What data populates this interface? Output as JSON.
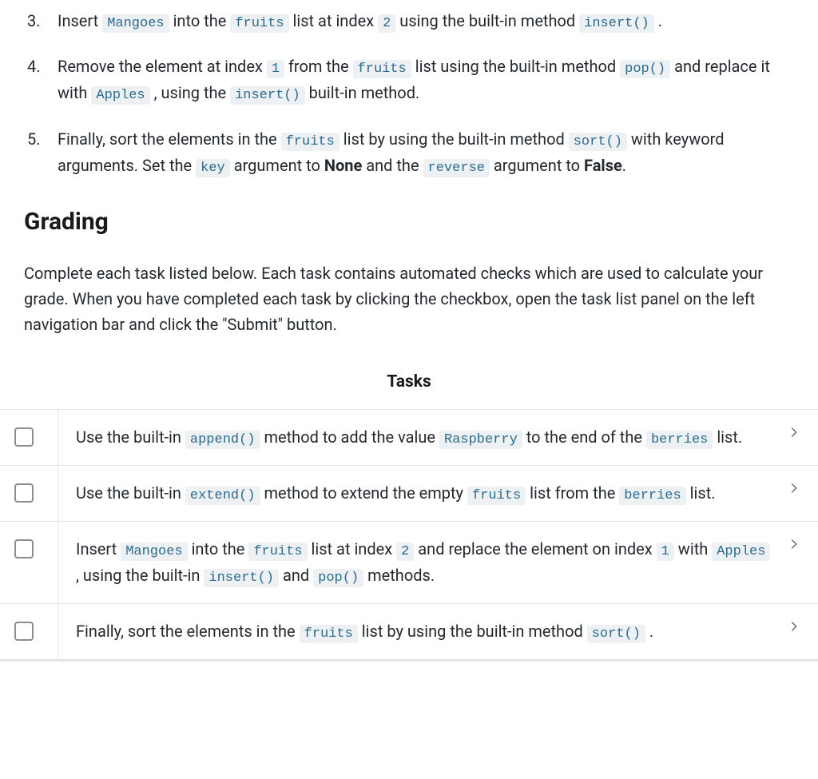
{
  "instructions": [
    {
      "num": "3.",
      "parts": [
        {
          "t": "text",
          "v": "Insert "
        },
        {
          "t": "code",
          "v": "Mangoes"
        },
        {
          "t": "text",
          "v": " into the "
        },
        {
          "t": "code",
          "v": "fruits"
        },
        {
          "t": "text",
          "v": " list at index "
        },
        {
          "t": "code",
          "v": "2"
        },
        {
          "t": "text",
          "v": " using the built-in method "
        },
        {
          "t": "code",
          "v": "insert()"
        },
        {
          "t": "text",
          "v": " ."
        }
      ]
    },
    {
      "num": "4.",
      "parts": [
        {
          "t": "text",
          "v": "Remove the element at index "
        },
        {
          "t": "code",
          "v": "1"
        },
        {
          "t": "text",
          "v": " from the "
        },
        {
          "t": "code",
          "v": "fruits"
        },
        {
          "t": "text",
          "v": " list using the built-in method "
        },
        {
          "t": "code",
          "v": "pop()"
        },
        {
          "t": "text",
          "v": " and replace it with "
        },
        {
          "t": "code",
          "v": "Apples"
        },
        {
          "t": "text",
          "v": " , using the "
        },
        {
          "t": "code",
          "v": "insert()"
        },
        {
          "t": "text",
          "v": " built-in method."
        }
      ]
    },
    {
      "num": "5.",
      "parts": [
        {
          "t": "text",
          "v": "Finally, sort the elements in the "
        },
        {
          "t": "code",
          "v": "fruits"
        },
        {
          "t": "text",
          "v": " list by using the built-in method "
        },
        {
          "t": "code",
          "v": "sort()"
        },
        {
          "t": "text",
          "v": " with keyword arguments. Set the "
        },
        {
          "t": "code",
          "v": "key"
        },
        {
          "t": "text",
          "v": " argument to "
        },
        {
          "t": "bold",
          "v": "None"
        },
        {
          "t": "text",
          "v": " and the "
        },
        {
          "t": "code",
          "v": "reverse"
        },
        {
          "t": "text",
          "v": " argument to "
        },
        {
          "t": "bold",
          "v": "False"
        },
        {
          "t": "text",
          "v": "."
        }
      ]
    }
  ],
  "grading": {
    "heading": "Grading",
    "desc": "Complete each task listed below. Each task contains automated checks which are used to calculate your grade. When you have completed each task by clicking the checkbox, open the task list panel on the left navigation bar and click the \"Submit\" button."
  },
  "tasks_header": "Tasks",
  "tasks": [
    {
      "parts": [
        {
          "t": "text",
          "v": "Use the built-in "
        },
        {
          "t": "code",
          "v": "append()"
        },
        {
          "t": "text",
          "v": " method to add the value "
        },
        {
          "t": "code",
          "v": "Raspberry"
        },
        {
          "t": "text",
          "v": " to the end of the "
        },
        {
          "t": "code",
          "v": "berries"
        },
        {
          "t": "text",
          "v": " list."
        }
      ]
    },
    {
      "parts": [
        {
          "t": "text",
          "v": "Use the built-in "
        },
        {
          "t": "code",
          "v": "extend()"
        },
        {
          "t": "text",
          "v": " method to extend the empty "
        },
        {
          "t": "code",
          "v": "fruits"
        },
        {
          "t": "text",
          "v": " list from the "
        },
        {
          "t": "code",
          "v": "berries"
        },
        {
          "t": "text",
          "v": " list."
        }
      ]
    },
    {
      "parts": [
        {
          "t": "text",
          "v": "Insert "
        },
        {
          "t": "code",
          "v": "Mangoes"
        },
        {
          "t": "text",
          "v": " into the "
        },
        {
          "t": "code",
          "v": "fruits"
        },
        {
          "t": "text",
          "v": " list at index "
        },
        {
          "t": "code",
          "v": "2"
        },
        {
          "t": "text",
          "v": " and replace the element on index "
        },
        {
          "t": "code",
          "v": "1"
        },
        {
          "t": "text",
          "v": " with "
        },
        {
          "t": "code",
          "v": "Apples"
        },
        {
          "t": "text",
          "v": " , using the built-in "
        },
        {
          "t": "code",
          "v": "insert()"
        },
        {
          "t": "text",
          "v": " and "
        },
        {
          "t": "code",
          "v": "pop()"
        },
        {
          "t": "text",
          "v": " methods."
        }
      ]
    },
    {
      "parts": [
        {
          "t": "text",
          "v": "Finally, sort the elements in the "
        },
        {
          "t": "code",
          "v": "fruits"
        },
        {
          "t": "text",
          "v": " list by using the built-in method "
        },
        {
          "t": "code",
          "v": "sort()"
        },
        {
          "t": "text",
          "v": " ."
        }
      ]
    }
  ]
}
